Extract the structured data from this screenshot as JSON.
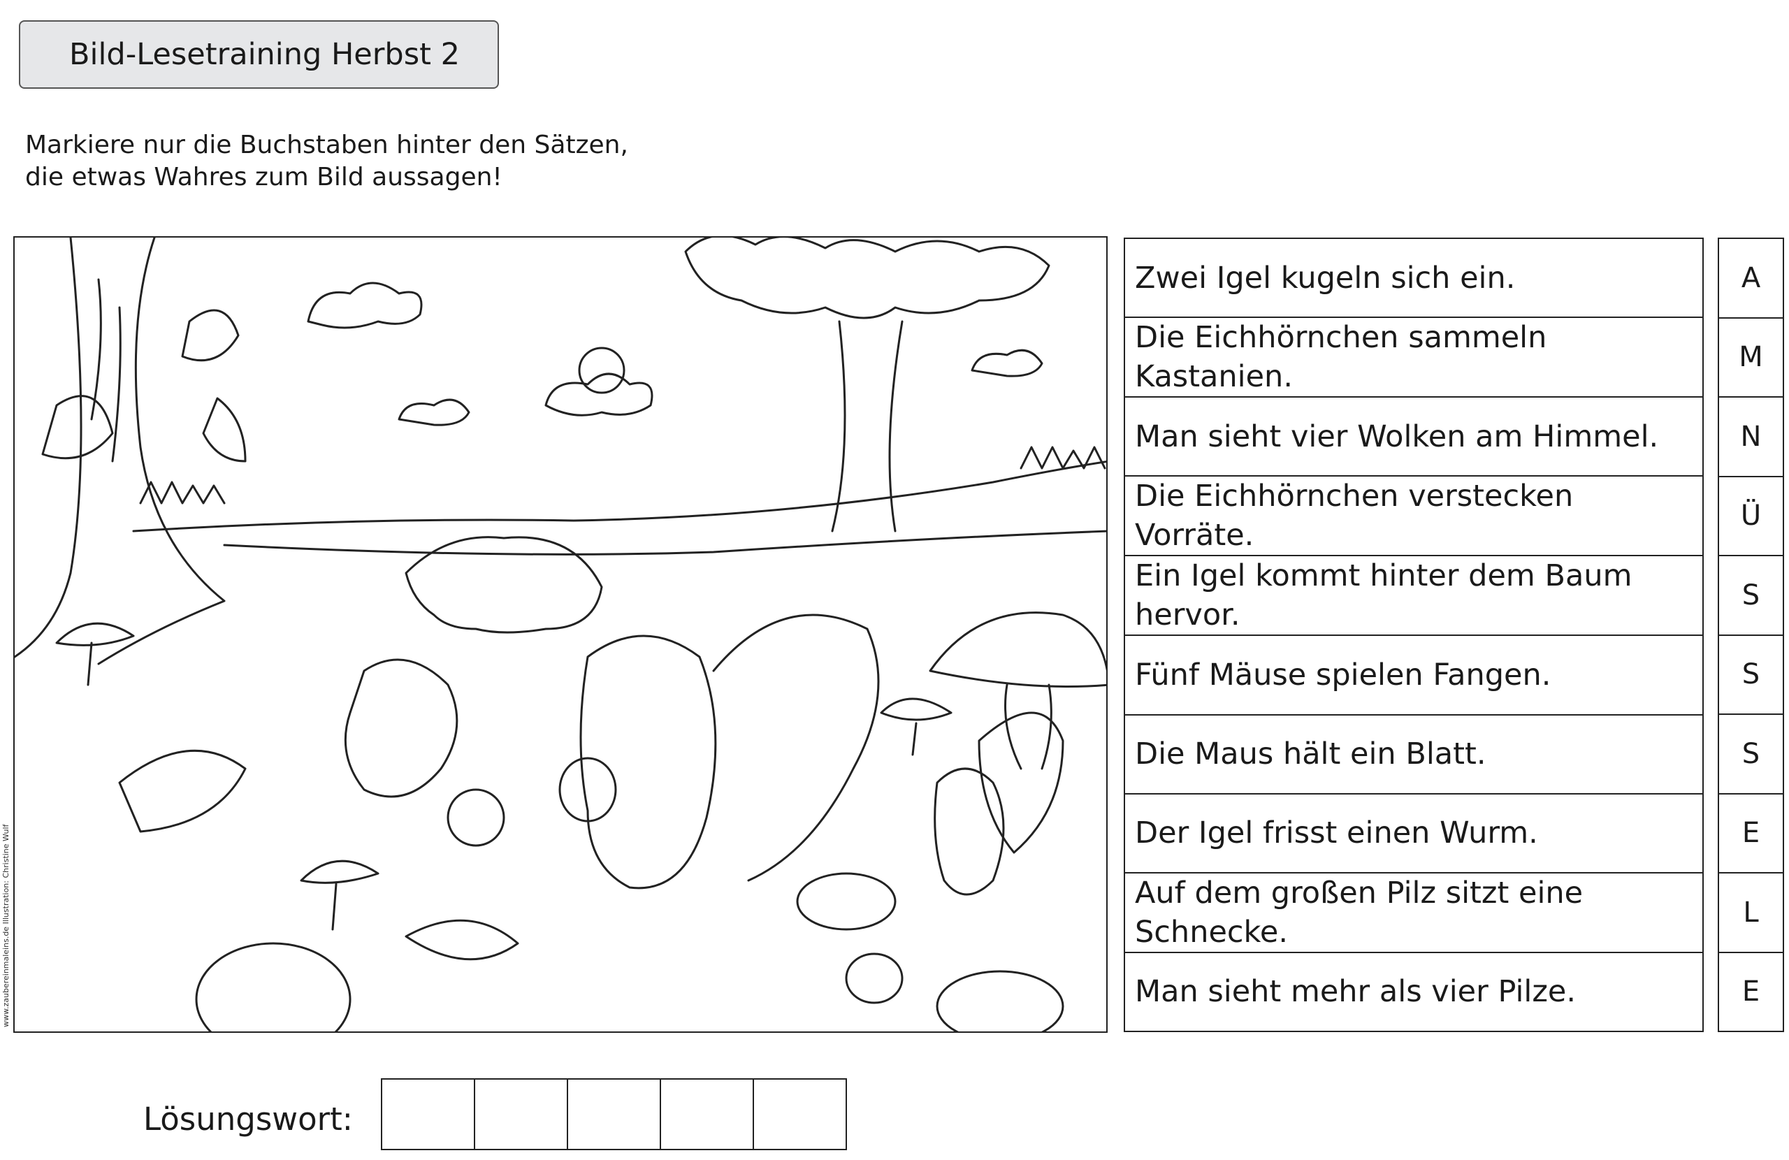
{
  "title": "Bild-Lesetraining Herbst 2",
  "instruction": {
    "line1": "Markiere nur die Buchstaben hinter den Sätzen,",
    "line2": "die etwas Wahres zum Bild aussagen!"
  },
  "credit": "www.zaubereinmaleins.de  Illustration: Christine Wulf",
  "statements": [
    {
      "text": "Zwei Igel kugeln sich ein.",
      "letter": "A"
    },
    {
      "text": "Die Eichhörnchen sammeln Kastanien.",
      "letter": "M"
    },
    {
      "text": "Man sieht vier Wolken am Himmel.",
      "letter": "N"
    },
    {
      "text": "Die Eichhörnchen verstecken Vorräte.",
      "letter": "Ü"
    },
    {
      "text": "Ein Igel kommt hinter dem Baum hervor.",
      "letter": "S"
    },
    {
      "text": "Fünf Mäuse spielen Fangen.",
      "letter": "S"
    },
    {
      "text": "Die Maus hält ein Blatt.",
      "letter": "S"
    },
    {
      "text": "Der Igel frisst einen Wurm.",
      "letter": "E"
    },
    {
      "text": "Auf dem großen Pilz sitzt eine Schnecke.",
      "letter": "L"
    },
    {
      "text": "Man sieht mehr als vier Pilze.",
      "letter": "E"
    }
  ],
  "solution": {
    "label": "Lösungswort:",
    "box_count": 5
  }
}
